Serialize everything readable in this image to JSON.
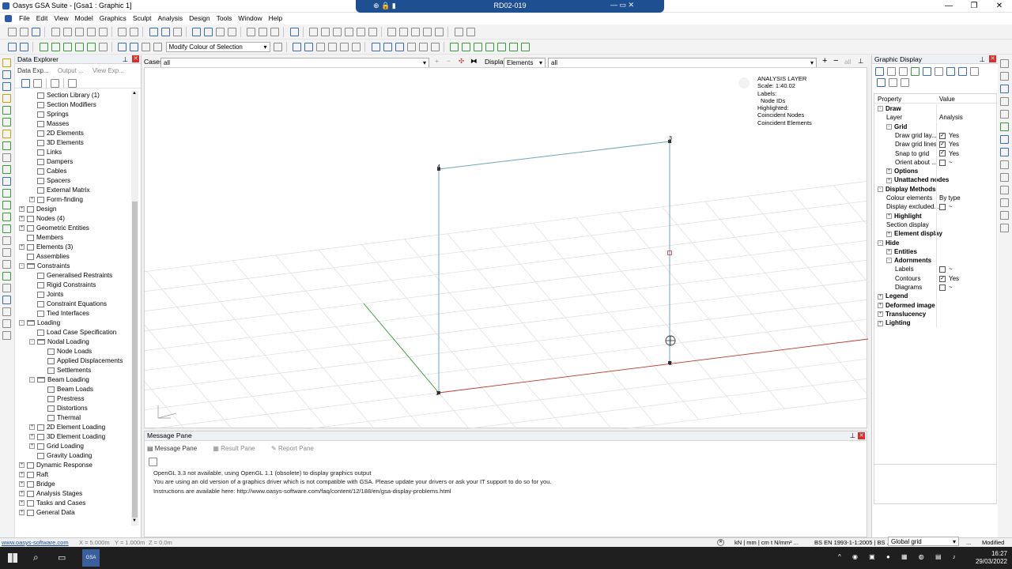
{
  "window": {
    "title": "Oasys GSA Suite - [Gsa1 : Graphic 1]",
    "remote_title": "RD02-019"
  },
  "menu": [
    "File",
    "Edit",
    "View",
    "Model",
    "Graphics",
    "Sculpt",
    "Analysis",
    "Design",
    "Tools",
    "Window",
    "Help"
  ],
  "toolbar": {
    "modify_combo": "Modify Colour of Selection"
  },
  "explorer": {
    "title": "Data Explorer",
    "tabs": [
      "Data Exp...",
      "Output ...",
      "View Exp..."
    ],
    "tree": [
      {
        "label": "Section Library (1)",
        "depth": 2,
        "exp": "",
        "folder": false
      },
      {
        "label": "Section Modifiers",
        "depth": 2,
        "exp": "",
        "folder": false
      },
      {
        "label": "Springs",
        "depth": 2,
        "exp": "",
        "folder": false
      },
      {
        "label": "Masses",
        "depth": 2,
        "exp": "",
        "folder": false
      },
      {
        "label": "2D Elements",
        "depth": 2,
        "exp": "",
        "folder": false
      },
      {
        "label": "3D Elements",
        "depth": 2,
        "exp": "",
        "folder": false
      },
      {
        "label": "Links",
        "depth": 2,
        "exp": "",
        "folder": false
      },
      {
        "label": "Dampers",
        "depth": 2,
        "exp": "",
        "folder": false
      },
      {
        "label": "Cables",
        "depth": 2,
        "exp": "",
        "folder": false
      },
      {
        "label": "Spacers",
        "depth": 2,
        "exp": "",
        "folder": false
      },
      {
        "label": "External Matrix",
        "depth": 2,
        "exp": "",
        "folder": false
      },
      {
        "label": "Form-finding",
        "depth": 2,
        "exp": "+",
        "folder": false
      },
      {
        "label": "Design",
        "depth": 1,
        "exp": "+",
        "folder": false
      },
      {
        "label": "Nodes (4)",
        "depth": 1,
        "exp": "+",
        "folder": false
      },
      {
        "label": "Geometric Entities",
        "depth": 1,
        "exp": "+",
        "folder": false
      },
      {
        "label": "Members",
        "depth": 1,
        "exp": "",
        "folder": false
      },
      {
        "label": "Elements (3)",
        "depth": 1,
        "exp": "+",
        "folder": false
      },
      {
        "label": "Assemblies",
        "depth": 1,
        "exp": "",
        "folder": false
      },
      {
        "label": "Constraints",
        "depth": 1,
        "exp": "-",
        "folder": true
      },
      {
        "label": "Generalised Restraints",
        "depth": 2,
        "exp": "",
        "folder": false
      },
      {
        "label": "Rigid Constraints",
        "depth": 2,
        "exp": "",
        "folder": false
      },
      {
        "label": "Joints",
        "depth": 2,
        "exp": "",
        "folder": false
      },
      {
        "label": "Constraint Equations",
        "depth": 2,
        "exp": "",
        "folder": false
      },
      {
        "label": "Tied Interfaces",
        "depth": 2,
        "exp": "",
        "folder": false
      },
      {
        "label": "Loading",
        "depth": 1,
        "exp": "-",
        "folder": true
      },
      {
        "label": "Load Case Specification",
        "depth": 2,
        "exp": "",
        "folder": false
      },
      {
        "label": "Nodal Loading",
        "depth": 2,
        "exp": "-",
        "folder": true
      },
      {
        "label": "Node Loads",
        "depth": 3,
        "exp": "",
        "folder": false
      },
      {
        "label": "Applied Displacements",
        "depth": 3,
        "exp": "",
        "folder": false
      },
      {
        "label": "Settlements",
        "depth": 3,
        "exp": "",
        "folder": false
      },
      {
        "label": "Beam Loading",
        "depth": 2,
        "exp": "-",
        "folder": true
      },
      {
        "label": "Beam Loads",
        "depth": 3,
        "exp": "",
        "folder": false
      },
      {
        "label": "Prestress",
        "depth": 3,
        "exp": "",
        "folder": false
      },
      {
        "label": "Distortions",
        "depth": 3,
        "exp": "",
        "folder": false
      },
      {
        "label": "Thermal",
        "depth": 3,
        "exp": "",
        "folder": false
      },
      {
        "label": "2D Element Loading",
        "depth": 2,
        "exp": "+",
        "folder": false
      },
      {
        "label": "3D Element Loading",
        "depth": 2,
        "exp": "+",
        "folder": false
      },
      {
        "label": "Grid Loading",
        "depth": 2,
        "exp": "+",
        "folder": false
      },
      {
        "label": "Gravity Loading",
        "depth": 2,
        "exp": "",
        "folder": false
      },
      {
        "label": "Dynamic Response",
        "depth": 1,
        "exp": "+",
        "folder": false
      },
      {
        "label": "Raft",
        "depth": 1,
        "exp": "+",
        "folder": false
      },
      {
        "label": "Bridge",
        "depth": 1,
        "exp": "+",
        "folder": false
      },
      {
        "label": "Analysis Stages",
        "depth": 1,
        "exp": "+",
        "folder": false
      },
      {
        "label": "Tasks and Cases",
        "depth": 1,
        "exp": "+",
        "folder": false
      },
      {
        "label": "General Data",
        "depth": 1,
        "exp": "+",
        "folder": false
      }
    ]
  },
  "graphic_bar": {
    "cases_label": "Cases",
    "cases_value": "all",
    "display_label": "Display",
    "display_value": "Elements",
    "filter_value": "all",
    "all_label": "all"
  },
  "graphic": {
    "layer_title": "ANALYSIS LAYER",
    "scale": "Scale: 1:40.02",
    "labels": "Labels:",
    "node_ids": "Node IDs",
    "highlighted": "Highlighted:",
    "coincident_nodes": "Coincident Nodes",
    "coincident_elements": "Coincident Elements",
    "node_labels": [
      "1",
      "2",
      "3",
      "4"
    ]
  },
  "props": {
    "title": "Graphic Display",
    "col_property": "Property",
    "col_value": "Value",
    "rows": [
      {
        "k": "Draw",
        "v": "",
        "lvl": 0,
        "exp": "-",
        "bold": true,
        "chk": ""
      },
      {
        "k": "Layer",
        "v": "Analysis",
        "lvl": 1,
        "exp": "",
        "bold": false,
        "chk": ""
      },
      {
        "k": "Grid",
        "v": "",
        "lvl": 1,
        "exp": "-",
        "bold": true,
        "chk": ""
      },
      {
        "k": "Draw grid lay...",
        "v": "Yes",
        "lvl": 2,
        "exp": "",
        "bold": false,
        "chk": "✓"
      },
      {
        "k": "Draw grid lines",
        "v": "Yes",
        "lvl": 2,
        "exp": "",
        "bold": false,
        "chk": "✓"
      },
      {
        "k": "Snap to grid",
        "v": "Yes",
        "lvl": 2,
        "exp": "",
        "bold": false,
        "chk": "✓"
      },
      {
        "k": "Orient about ...",
        "v": "~",
        "lvl": 2,
        "exp": "",
        "bold": false,
        "chk": " "
      },
      {
        "k": "Options",
        "v": "",
        "lvl": 1,
        "exp": "+",
        "bold": true,
        "chk": ""
      },
      {
        "k": "Unattached nodes",
        "v": "",
        "lvl": 1,
        "exp": "+",
        "bold": true,
        "chk": ""
      },
      {
        "k": "Display Methods",
        "v": "",
        "lvl": 0,
        "exp": "-",
        "bold": true,
        "chk": ""
      },
      {
        "k": "Colour elements",
        "v": "By type",
        "lvl": 1,
        "exp": "",
        "bold": false,
        "chk": ""
      },
      {
        "k": "Display excluded...",
        "v": "~",
        "lvl": 1,
        "exp": "",
        "bold": false,
        "chk": " "
      },
      {
        "k": "Highlight",
        "v": "",
        "lvl": 1,
        "exp": "+",
        "bold": true,
        "chk": ""
      },
      {
        "k": "Section display",
        "v": "",
        "lvl": 1,
        "exp": "",
        "bold": false,
        "chk": ""
      },
      {
        "k": "Element display",
        "v": "",
        "lvl": 1,
        "exp": "+",
        "bold": true,
        "chk": ""
      },
      {
        "k": "Hide",
        "v": "",
        "lvl": 0,
        "exp": "-",
        "bold": true,
        "chk": ""
      },
      {
        "k": "Entities",
        "v": "",
        "lvl": 1,
        "exp": "+",
        "bold": true,
        "chk": ""
      },
      {
        "k": "Adornments",
        "v": "",
        "lvl": 1,
        "exp": "-",
        "bold": true,
        "chk": ""
      },
      {
        "k": "Labels",
        "v": "~",
        "lvl": 2,
        "exp": "",
        "bold": false,
        "chk": " "
      },
      {
        "k": "Contours",
        "v": "Yes",
        "lvl": 2,
        "exp": "",
        "bold": false,
        "chk": "✓"
      },
      {
        "k": "Diagrams",
        "v": "~",
        "lvl": 2,
        "exp": "",
        "bold": false,
        "chk": " "
      },
      {
        "k": "Legend",
        "v": "",
        "lvl": 0,
        "exp": "+",
        "bold": true,
        "chk": ""
      },
      {
        "k": "Deformed image",
        "v": "",
        "lvl": 0,
        "exp": "+",
        "bold": true,
        "chk": ""
      },
      {
        "k": "Translucency",
        "v": "",
        "lvl": 0,
        "exp": "+",
        "bold": true,
        "chk": ""
      },
      {
        "k": "Lighting",
        "v": "",
        "lvl": 0,
        "exp": "+",
        "bold": true,
        "chk": ""
      }
    ]
  },
  "message": {
    "title": "Message Pane",
    "tabs": [
      "Message Pane",
      "Result Pane",
      "Report Pane"
    ],
    "lines": [
      "OpenGL 3.3 not available, using OpenGL 1.1 (obsolete) to display graphics output",
      "You are using an old version of a graphics driver which is not compatible with GSA. Please update your drivers or ask your IT support to do so for you.",
      "Instructions are available here: http://www.oasys-software.com/faq/content/12/188/en/gsa-display-problems.html"
    ]
  },
  "status": {
    "link": "www.oasys-software.com",
    "x": "X = 5.000m",
    "y": "Y = 1.000m",
    "z": "Z = 0.0m",
    "units": "kN | mm | cm  t  N/mm²  ...",
    "code": "BS EN 1993-1-1:2005 | BS ...",
    "grid": "Global grid",
    "more": "...",
    "modified": "Modified"
  },
  "taskbar": {
    "app": "GSA",
    "time": "16:27",
    "date": "29/03/2022"
  },
  "colors": {
    "accent": "#1e4f91",
    "member": "#6fa6b3",
    "x_axis": "#c0392b",
    "y_axis": "#2e9b2e"
  }
}
